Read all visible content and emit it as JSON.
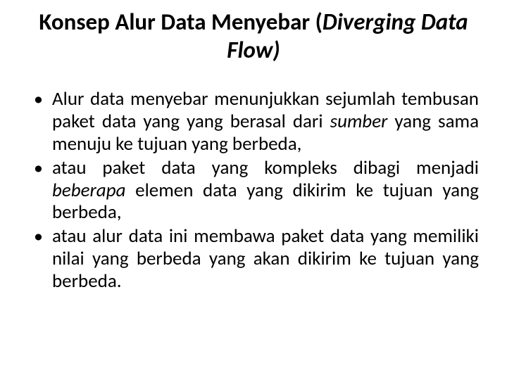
{
  "title_plain": "Konsep Alur Data Menyebar (",
  "title_italic": "Diverging Data Flow)",
  "bullets": [
    {
      "pre": "Alur data menyebar menunjukkan sejumlah tembusan paket data yang yang berasal dari ",
      "italic": "sumber",
      "post": " yang sama menuju ke tujuan yang berbeda,"
    },
    {
      "pre": "atau paket data yang kompleks dibagi menjadi ",
      "italic": "beberapa",
      "post": " elemen data yang dikirim ke tujuan yang berbeda,"
    },
    {
      "pre": "atau alur data ini membawa paket data yang memiliki nilai yang berbeda yang akan dikirim ke tujuan yang berbeda.",
      "italic": "",
      "post": ""
    }
  ]
}
